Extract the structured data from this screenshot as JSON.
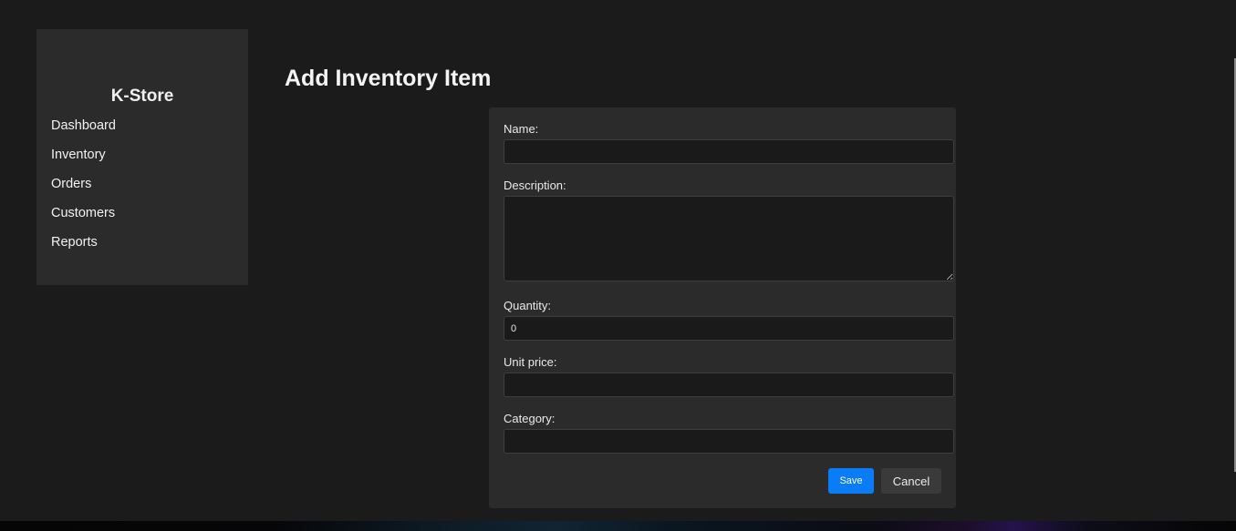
{
  "sidebar": {
    "brand": "K-Store",
    "items": [
      {
        "label": "Dashboard"
      },
      {
        "label": "Inventory"
      },
      {
        "label": "Orders"
      },
      {
        "label": "Customers"
      },
      {
        "label": "Reports"
      }
    ]
  },
  "main": {
    "title": "Add Inventory Item"
  },
  "form": {
    "name": {
      "label": "Name:",
      "value": ""
    },
    "description": {
      "label": "Description:",
      "value": ""
    },
    "quantity": {
      "label": "Quantity:",
      "value": "0"
    },
    "unit_price": {
      "label": "Unit price:",
      "value": ""
    },
    "category": {
      "label": "Category:",
      "value": ""
    },
    "save_label": "Save",
    "cancel_label": "Cancel"
  },
  "colors": {
    "background": "#1b1b1b",
    "panel": "#2b2b2b",
    "accent": "#0a7cf5"
  }
}
